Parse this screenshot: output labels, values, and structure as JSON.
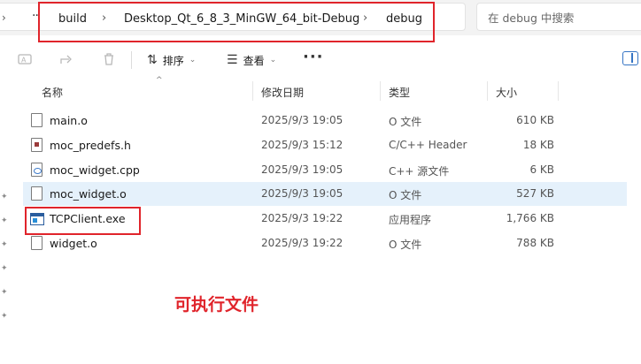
{
  "address_bar": {
    "more": "··",
    "crumbs": [
      "build",
      "Desktop_Qt_6_8_3_MinGW_64_bit-Debug",
      "debug"
    ]
  },
  "search": {
    "placeholder": "在 debug 中搜索"
  },
  "toolbar": {
    "sort_label": "排序",
    "view_label": "查看",
    "more": "···"
  },
  "columns": {
    "name": "名称",
    "date": "修改日期",
    "type": "类型",
    "size": "大小"
  },
  "files": [
    {
      "name": "main.o",
      "date": "2025/9/3 19:05",
      "type": "O 文件",
      "size": "610 KB",
      "icon": "doc"
    },
    {
      "name": "moc_predefs.h",
      "date": "2025/9/3 15:12",
      "type": "C/C++ Header",
      "size": "18 KB",
      "icon": "header"
    },
    {
      "name": "moc_widget.cpp",
      "date": "2025/9/3 19:05",
      "type": "C++ 源文件",
      "size": "6 KB",
      "icon": "cpp"
    },
    {
      "name": "moc_widget.o",
      "date": "2025/9/3 19:05",
      "type": "O 文件",
      "size": "527 KB",
      "icon": "doc",
      "selected": true
    },
    {
      "name": "TCPClient.exe",
      "date": "2025/9/3 19:22",
      "type": "应用程序",
      "size": "1,766 KB",
      "icon": "exe"
    },
    {
      "name": "widget.o",
      "date": "2025/9/3 19:22",
      "type": "O 文件",
      "size": "788 KB",
      "icon": "doc"
    }
  ],
  "annotation": "可执行文件",
  "colors": {
    "highlight": "#e0242b",
    "selected_row": "#e5f1fb",
    "accent": "#3574c4"
  }
}
